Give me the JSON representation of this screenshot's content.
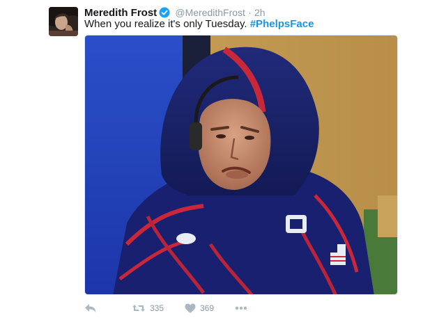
{
  "tweet": {
    "author_name": "Meredith Frost",
    "handle": "@MeredithFrost",
    "separator": "·",
    "time": "2h",
    "text": "When you realize it's only Tuesday.",
    "hashtag": "#PhelpsFace",
    "verified": true
  },
  "actions": {
    "reply_icon": "reply-icon",
    "retweet_icon": "retweet-icon",
    "retweet_count": "335",
    "like_icon": "heart-icon",
    "like_count": "369",
    "more_icon": "more-icon"
  },
  "colors": {
    "hashtag": "#1b95e0",
    "verified": "#1da1f2",
    "muted": "#8899a6",
    "icon": "#aab8c2"
  }
}
